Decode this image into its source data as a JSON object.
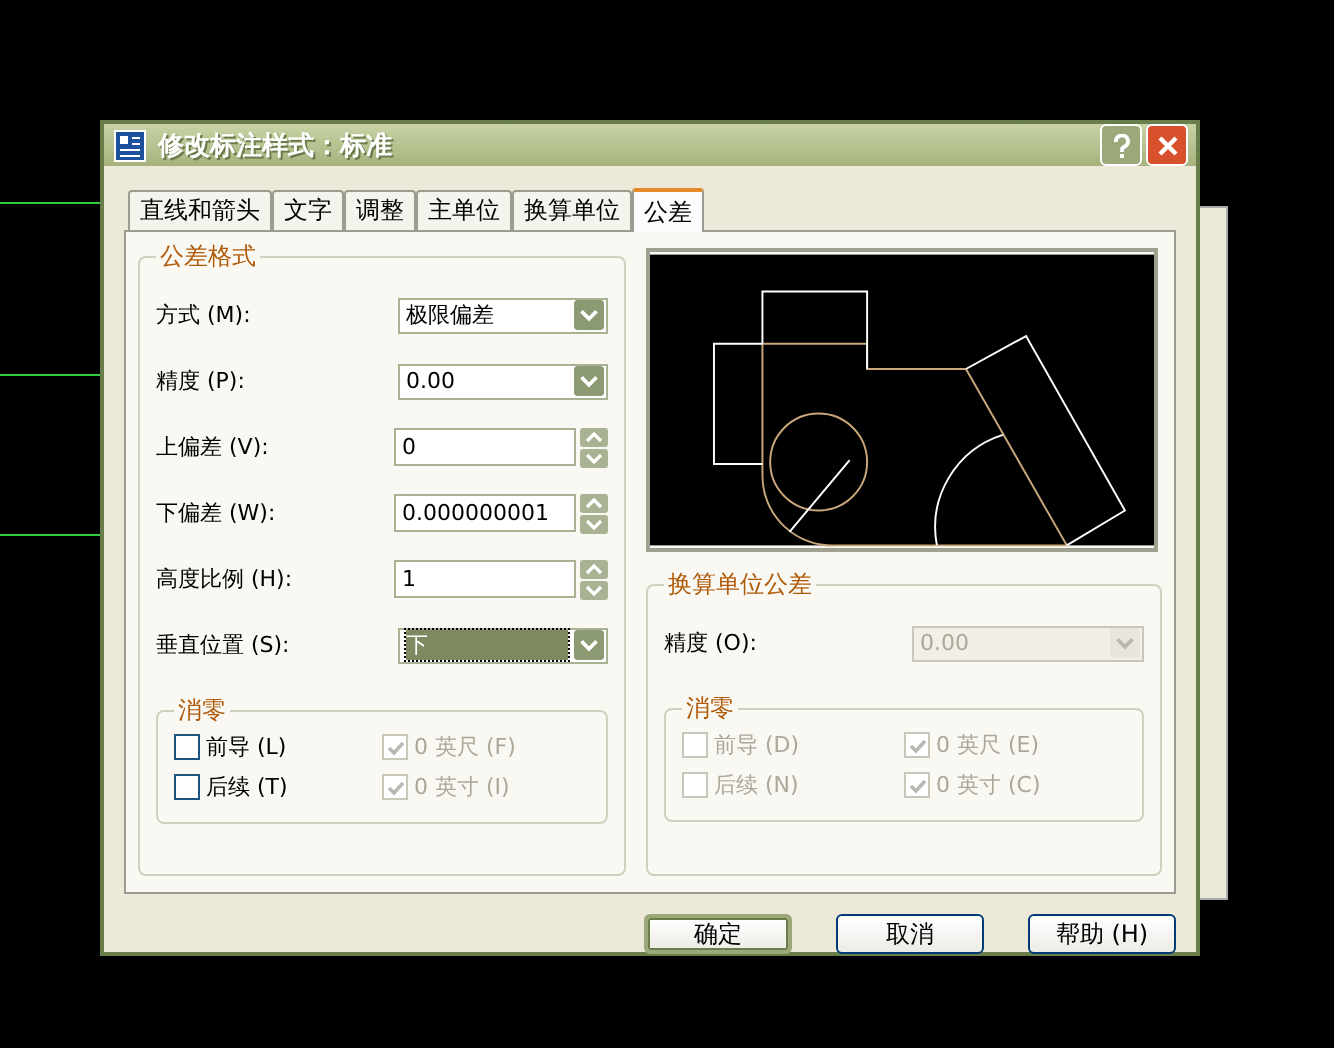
{
  "window": {
    "title": "修改标注样式：标准"
  },
  "tabs": [
    {
      "label": "直线和箭头",
      "selected": false
    },
    {
      "label": "文字",
      "selected": false
    },
    {
      "label": "调整",
      "selected": false
    },
    {
      "label": "主单位",
      "selected": false
    },
    {
      "label": "换算单位",
      "selected": false
    },
    {
      "label": "公差",
      "selected": true
    }
  ],
  "tolerance_format": {
    "title": "公差格式",
    "fields": [
      {
        "kind": "select",
        "label": "方式 (M):",
        "value": "极限偏差",
        "focused": false
      },
      {
        "kind": "select",
        "label": "精度 (P):",
        "value": "0.00",
        "focused": false
      },
      {
        "kind": "spin",
        "label": "上偏差 (V):",
        "value": "0",
        "focused": false
      },
      {
        "kind": "spin",
        "label": "下偏差 (W):",
        "value": "0.000000001",
        "focused": false
      },
      {
        "kind": "spin",
        "label": "高度比例 (H):",
        "value": "1",
        "focused": false
      },
      {
        "kind": "select",
        "label": "垂直位置 (S):",
        "value": "下",
        "focused": true
      }
    ],
    "zero_suppression": {
      "title": "消零",
      "options": [
        {
          "label": "前导 (L)",
          "checked": false,
          "disabled": false
        },
        {
          "label": "0 英尺 (F)",
          "checked": true,
          "disabled": true
        },
        {
          "label": "后续 (T)",
          "checked": false,
          "disabled": false
        },
        {
          "label": "0 英寸 (I)",
          "checked": true,
          "disabled": true
        }
      ]
    }
  },
  "alternate_tolerance": {
    "title": "换算单位公差",
    "precision": {
      "label": "精度 (O):",
      "value": "0.00",
      "disabled": true
    },
    "zero_suppression": {
      "title": "消零",
      "options": [
        {
          "label": "前导 (D)",
          "checked": false,
          "disabled": true
        },
        {
          "label": "0 英尺 (E)",
          "checked": true,
          "disabled": true
        },
        {
          "label": "后续 (N)",
          "checked": false,
          "disabled": true
        },
        {
          "label": "0 英寸 (C)",
          "checked": true,
          "disabled": true
        }
      ]
    }
  },
  "buttons": [
    {
      "label": "确定",
      "default": true
    },
    {
      "label": "取消",
      "default": false
    },
    {
      "label": "帮助 (H)",
      "default": false
    }
  ]
}
